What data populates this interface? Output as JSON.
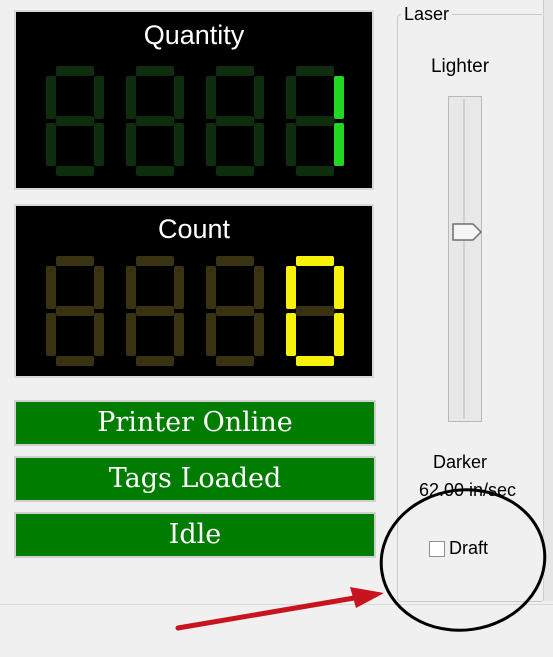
{
  "quantity": {
    "title": "Quantity",
    "digits": [
      "",
      "",
      "",
      "1"
    ]
  },
  "count": {
    "title": "Count",
    "digits": [
      "",
      "",
      "",
      "0"
    ]
  },
  "status": [
    "Printer Online",
    "Tags Loaded",
    "Idle"
  ],
  "laser": {
    "legend": "Laser",
    "lighter_label": "Lighter",
    "darker_label": "Darker",
    "speed": "62.00 in/sec",
    "draft_label": "Draft",
    "draft_checked": false,
    "slider_level_from_top": 0.42
  },
  "colors": {
    "status_green": "#007c00",
    "digit_green_on": "#22d822",
    "digit_green_off": "#0d2d0d",
    "digit_yellow_on": "#f7f20c",
    "digit_yellow_off": "#3a3312",
    "annotation_arrow": "#c8141e",
    "annotation_circle": "#000000"
  }
}
